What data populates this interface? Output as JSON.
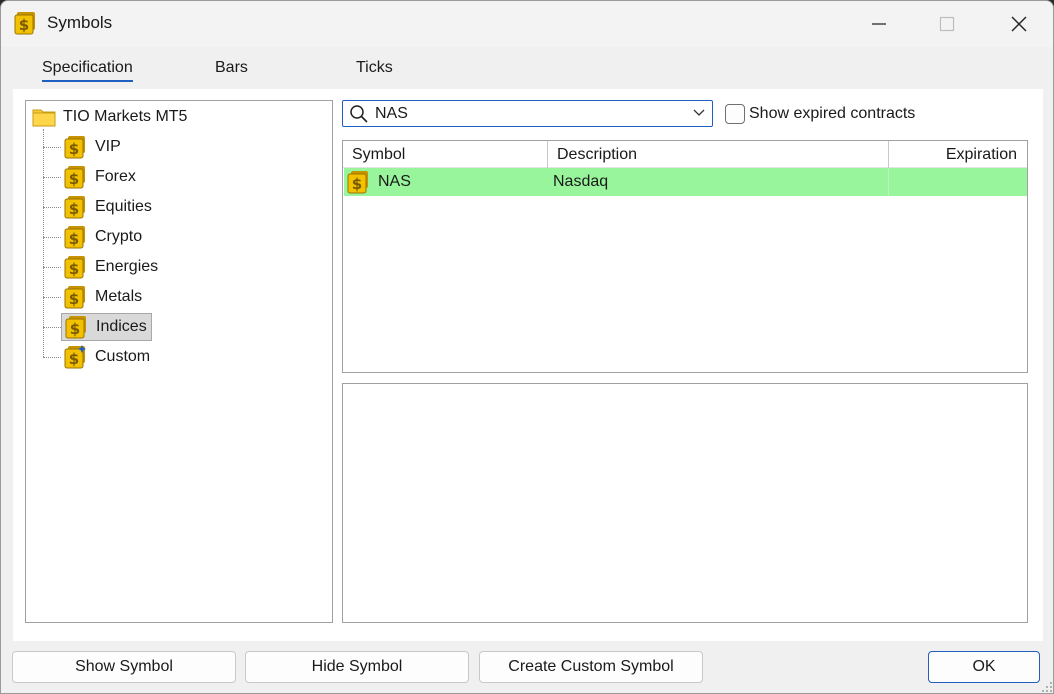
{
  "window": {
    "title": "Symbols"
  },
  "tabs": [
    {
      "label": "Specification",
      "active": true
    },
    {
      "label": "Bars",
      "active": false
    },
    {
      "label": "Ticks",
      "active": false
    }
  ],
  "tree": {
    "root": "TIO Markets MT5",
    "items": [
      {
        "label": "VIP",
        "icon": "dollar-symbol-icon"
      },
      {
        "label": "Forex",
        "icon": "dollar-symbol-icon"
      },
      {
        "label": "Equities",
        "icon": "dollar-symbol-icon"
      },
      {
        "label": "Crypto",
        "icon": "dollar-symbol-icon"
      },
      {
        "label": "Energies",
        "icon": "dollar-symbol-icon"
      },
      {
        "label": "Metals",
        "icon": "dollar-symbol-icon"
      },
      {
        "label": "Indices",
        "icon": "dollar-symbol-icon",
        "selected": true
      },
      {
        "label": "Custom",
        "icon": "custom-symbol-icon"
      }
    ]
  },
  "search": {
    "value": "NAS",
    "placeholder": ""
  },
  "show_expired": {
    "label": "Show expired contracts",
    "checked": false
  },
  "table": {
    "columns": [
      "Symbol",
      "Description",
      "Expiration"
    ],
    "rows": [
      {
        "symbol": "NAS",
        "description": "Nasdaq",
        "expiration": ""
      }
    ]
  },
  "buttons": {
    "show_symbol": "Show Symbol",
    "hide_symbol": "Hide Symbol",
    "create_custom_symbol": "Create Custom Symbol",
    "ok": "OK"
  },
  "colors": {
    "selected_row": "#99f59b",
    "accent": "#1f5fbf",
    "symbol_icon": "#f2c200"
  }
}
